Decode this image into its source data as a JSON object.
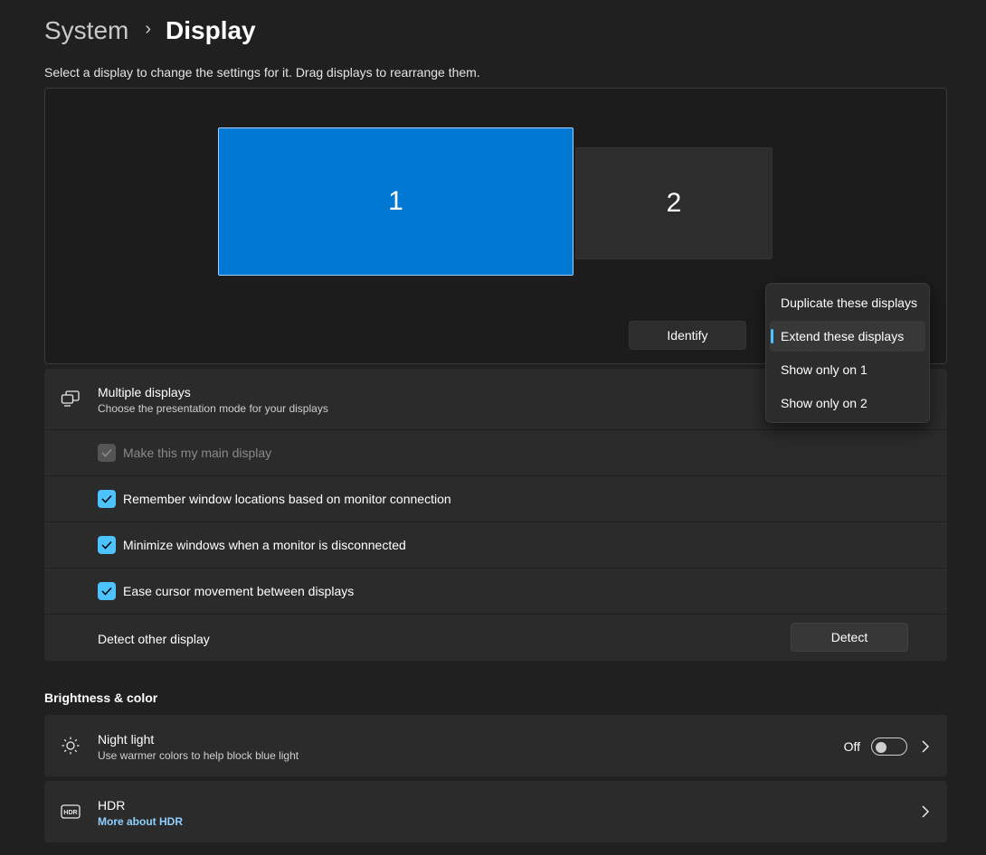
{
  "breadcrumb": {
    "parent": "System",
    "separator": "›",
    "current": "Display"
  },
  "subtitle": "Select a display to change the settings for it. Drag displays to rearrange them.",
  "arrangement": {
    "monitors": [
      {
        "label": "1",
        "selected": true
      },
      {
        "label": "2",
        "selected": false
      }
    ],
    "identify_label": "Identify"
  },
  "multiple_displays": {
    "icon": "multiple-displays-icon",
    "title": "Multiple displays",
    "description": "Choose the presentation mode for your displays",
    "options": [
      {
        "label": "Make this my main display",
        "checked": true,
        "disabled": true
      },
      {
        "label": "Remember window locations based on monitor connection",
        "checked": true,
        "disabled": false
      },
      {
        "label": "Minimize windows when a monitor is disconnected",
        "checked": true,
        "disabled": false
      },
      {
        "label": "Ease cursor movement between displays",
        "checked": true,
        "disabled": false
      }
    ],
    "detect_label": "Detect other display",
    "detect_button": "Detect"
  },
  "dropdown": {
    "items": [
      {
        "label": "Duplicate these displays",
        "selected": false
      },
      {
        "label": "Extend these displays",
        "selected": true
      },
      {
        "label": "Show only on 1",
        "selected": false
      },
      {
        "label": "Show only on 2",
        "selected": false
      }
    ]
  },
  "brightness_color": {
    "heading": "Brightness & color",
    "night_light": {
      "icon": "night-light-icon",
      "title": "Night light",
      "description": "Use warmer colors to help block blue light",
      "state_label": "Off",
      "on": false
    },
    "hdr": {
      "icon": "hdr-icon",
      "title": "HDR",
      "link": "More about HDR"
    }
  },
  "colors": {
    "accent": "#0078d4",
    "checkbox": "#4cc2ff",
    "link": "#8fd0ff",
    "background": "#202020",
    "card": "#2b2b2b"
  }
}
